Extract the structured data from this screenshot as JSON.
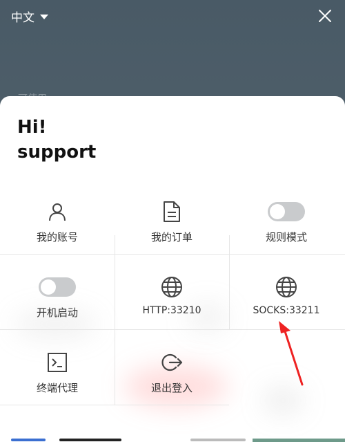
{
  "header": {
    "language": "中文",
    "language_dropdown_icon": "caret-down-icon",
    "close_icon": "close-icon",
    "obscured_text": "可使用"
  },
  "greeting": {
    "line1": "Hi!",
    "line2": "support"
  },
  "grid": {
    "items": [
      {
        "label": "我的账号",
        "icon": "user-icon"
      },
      {
        "label": "我的订单",
        "icon": "document-icon"
      },
      {
        "label": "规则模式",
        "icon": "toggle-switch",
        "state": "off"
      },
      {
        "label": "开机启动",
        "icon": "toggle-switch",
        "state": "off"
      },
      {
        "label": "HTTP:33210",
        "icon": "globe-icon"
      },
      {
        "label": "SOCKS:33211",
        "icon": "globe-icon"
      },
      {
        "label": "终端代理",
        "icon": "terminal-icon"
      },
      {
        "label": "退出登入",
        "icon": "logout-icon"
      }
    ]
  },
  "colors": {
    "header_bg": "#495a66",
    "panel_bg": "#ffffff",
    "icon": "#444444",
    "toggle_off": "#c9cbcd",
    "annotation_arrow": "#ee2222"
  }
}
